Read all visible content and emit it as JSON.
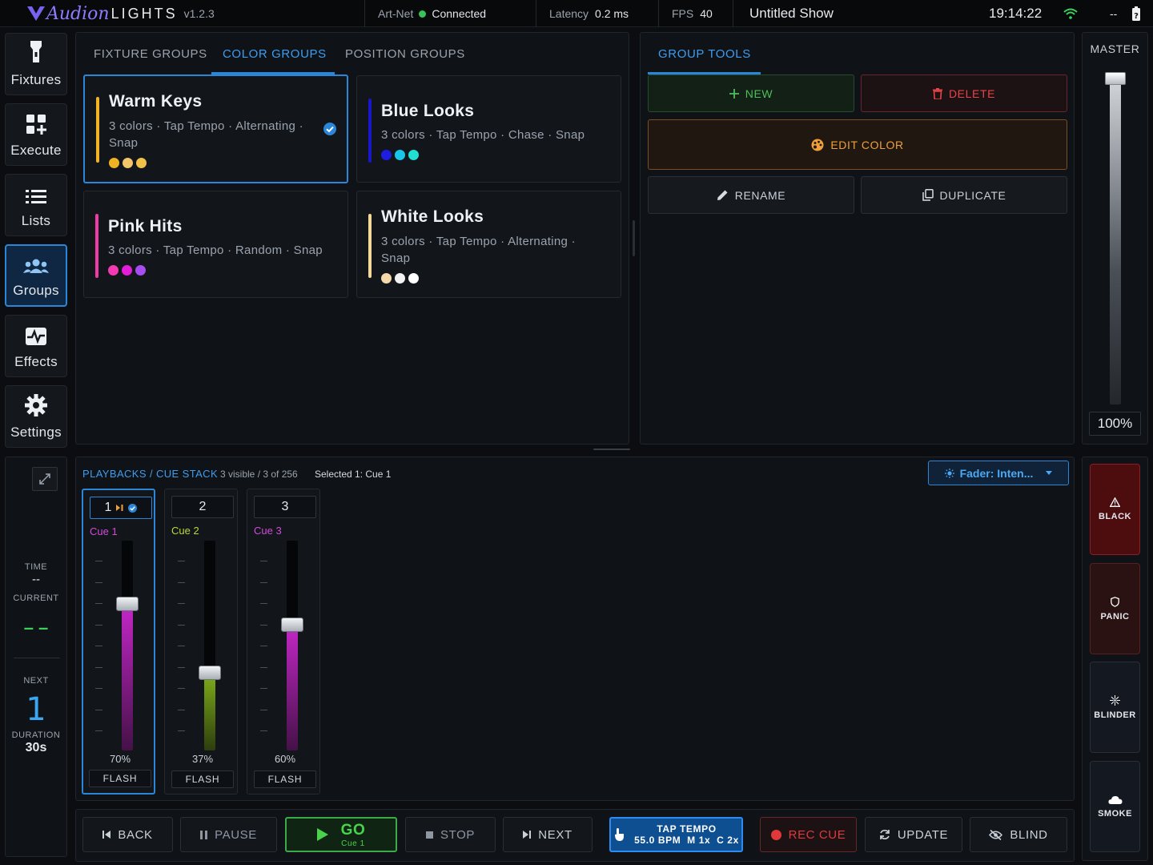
{
  "topbar": {
    "logo_part1": "Audion",
    "logo_part2": "LIGHTS",
    "version": "v1.2.3",
    "artnet_label": "Art-Net",
    "artnet_status": "Connected",
    "latency_label": "Latency",
    "latency_value": "0.2 ms",
    "fps_label": "FPS",
    "fps_value": "40",
    "show_name": "Untitled Show",
    "clock": "19:14:22",
    "status_dashes": "--"
  },
  "sidebar": {
    "items": [
      {
        "label": "Fixtures",
        "icon": "flashlight-icon"
      },
      {
        "label": "Execute",
        "icon": "grid-plus-icon"
      },
      {
        "label": "Lists",
        "icon": "list-icon"
      },
      {
        "label": "Groups",
        "icon": "people-icon",
        "active": true
      },
      {
        "label": "Effects",
        "icon": "pulse-icon"
      },
      {
        "label": "Settings",
        "icon": "gear-icon"
      }
    ]
  },
  "groups": {
    "tabs": [
      "FIXTURE GROUPS",
      "COLOR GROUPS",
      "POSITION GROUPS"
    ],
    "active_tab": 1,
    "cards": [
      {
        "title": "Warm Keys",
        "sub1": "3 colors · Tap Tempo · Alternating ·",
        "sub2": "Snap",
        "bar_color": "#f2b322",
        "swatches": [
          "#f2b322",
          "#f3c56a",
          "#f1c04a"
        ],
        "selected": true
      },
      {
        "title": "Blue Looks",
        "sub1": "3 colors · Tap Tempo · Chase · Snap",
        "sub2": "",
        "bar_color": "#1a16c9",
        "swatches": [
          "#1d1ee0",
          "#19c6e8",
          "#20e0d2"
        ],
        "selected": false
      },
      {
        "title": "Pink Hits",
        "sub1": "3 colors · Tap Tempo · Random · Snap",
        "sub2": "",
        "bar_color": "#f03aa8",
        "swatches": [
          "#f23bb0",
          "#e21ed8",
          "#a54df0"
        ],
        "selected": false
      },
      {
        "title": "White Looks",
        "sub1": "3 colors · Tap Tempo · Alternating ·",
        "sub2": "Snap",
        "bar_color": "#f3d89a",
        "swatches": [
          "#f5d9a8",
          "#f2f2f2",
          "#ffffff"
        ],
        "selected": false
      }
    ]
  },
  "group_tools": {
    "title": "GROUP TOOLS",
    "new_label": "NEW",
    "delete_label": "DELETE",
    "edit_color_label": "EDIT COLOR",
    "rename_label": "RENAME",
    "duplicate_label": "DUPLICATE"
  },
  "master": {
    "label": "MASTER",
    "value_text": "100%",
    "level": 1.0
  },
  "status_panel": {
    "time_label": "TIME",
    "time_value": "--",
    "current_label": "CURRENT",
    "current_value": "– –",
    "next_label": "NEXT",
    "next_value": "1",
    "duration_label": "DURATION",
    "duration_value": "30s"
  },
  "cue_stack": {
    "title": "PLAYBACKS / CUE STACK",
    "visible_info": "3 visible / 3 of 256",
    "selected_info": "Selected 1: Cue 1",
    "fader_mode": "Fader: Inten...",
    "flash_label": "FLASH",
    "cues": [
      {
        "number": "1",
        "name": "Cue 1",
        "name_color": "#d24ad9",
        "level": 0.7,
        "pct": "70%",
        "fill_color": "#c427c8",
        "selected": true
      },
      {
        "number": "2",
        "name": "Cue 2",
        "name_color": "#b8d838",
        "level": 0.37,
        "pct": "37%",
        "fill_color": "#7fae1a",
        "selected": false
      },
      {
        "number": "3",
        "name": "Cue 3",
        "name_color": "#d24ad9",
        "level": 0.6,
        "pct": "60%",
        "fill_color": "#c427c8",
        "selected": false
      }
    ]
  },
  "transport": {
    "back": "BACK",
    "pause": "PAUSE",
    "go": "GO",
    "go_sub": "Cue 1",
    "stop": "STOP",
    "next": "NEXT",
    "tap_title": "TAP TEMPO",
    "tap_info": "55.0 BPM  M 1x  C 2x",
    "rec_cue": "REC CUE",
    "update": "UPDATE",
    "blind": "BLIND"
  },
  "emergency": {
    "black": "BLACK",
    "panic": "PANIC",
    "blinder": "BLINDER",
    "smoke": "SMOKE"
  },
  "colors": {
    "accent": "#2b86d8",
    "go_green": "#4ad34a",
    "rec_red": "#e0383b",
    "edit_orange": "#f0a03a"
  }
}
